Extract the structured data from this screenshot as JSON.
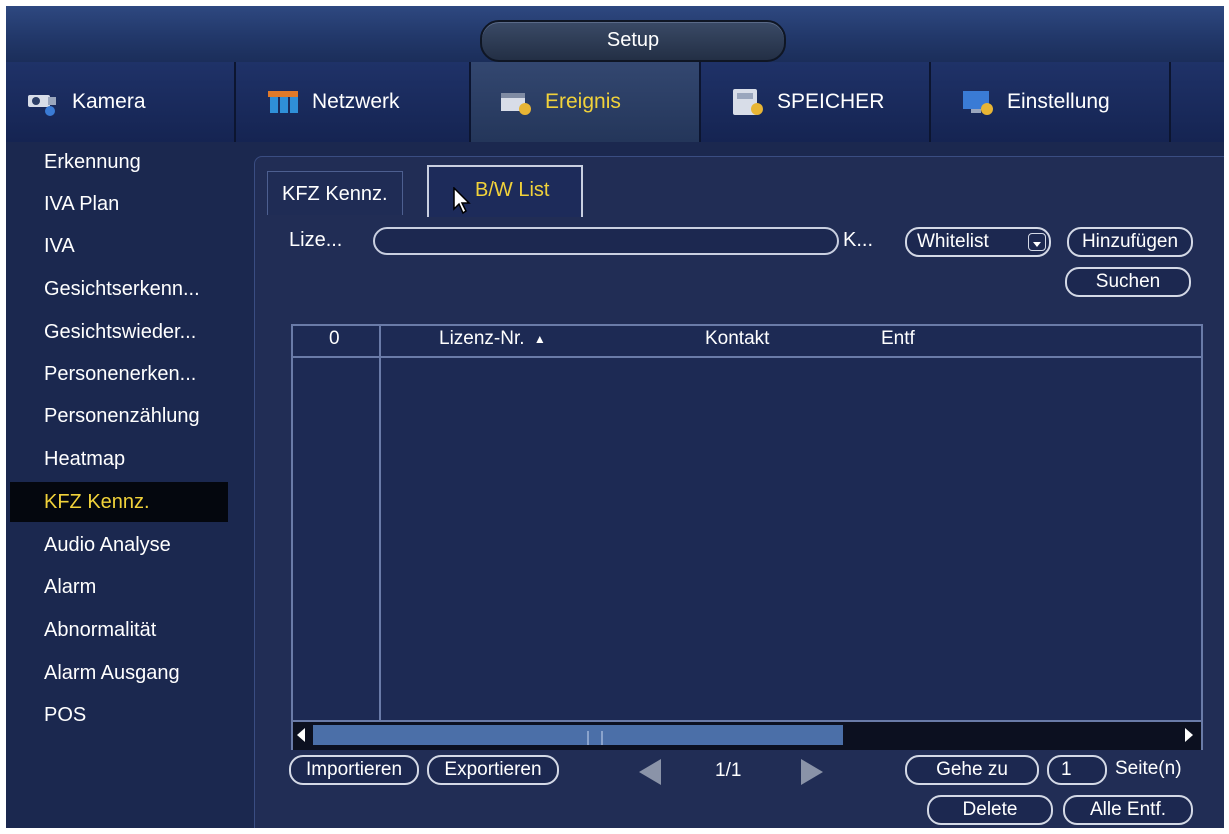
{
  "window": {
    "title": "Setup"
  },
  "top_tabs": [
    {
      "label": "Kamera",
      "icon": "camera-icon"
    },
    {
      "label": "Netzwerk",
      "icon": "network-icon"
    },
    {
      "label": "Ereignis",
      "icon": "event-icon",
      "active": true
    },
    {
      "label": "SPEICHER",
      "icon": "storage-icon"
    },
    {
      "label": "Einstellung",
      "icon": "settings-icon"
    }
  ],
  "sidebar": {
    "items": [
      {
        "label": "Erkennung"
      },
      {
        "label": "IVA Plan"
      },
      {
        "label": "IVA"
      },
      {
        "label": "Gesichtserkenn..."
      },
      {
        "label": "Gesichtswieder..."
      },
      {
        "label": "Personenerken..."
      },
      {
        "label": "Personenzählung"
      },
      {
        "label": "Heatmap"
      },
      {
        "label": "KFZ Kennz.",
        "active": true
      },
      {
        "label": "Audio Analyse"
      },
      {
        "label": "Alarm"
      },
      {
        "label": "Abnormalität"
      },
      {
        "label": "Alarm Ausgang"
      },
      {
        "label": "POS"
      }
    ]
  },
  "sub_tabs": [
    {
      "label": "KFZ Kennz."
    },
    {
      "label": "B/W List",
      "active": true
    }
  ],
  "form": {
    "license_label": "Lize...",
    "license_value": "",
    "k_label": "K...",
    "list_type": "Whitelist",
    "add_label": "Hinzufügen",
    "search_label": "Suchen"
  },
  "table": {
    "count": "0",
    "columns": [
      "Lizenz-Nr.",
      "Kontakt",
      "Entf"
    ],
    "sort_indicator": "▲",
    "rows": []
  },
  "footer": {
    "import_label": "Importieren",
    "export_label": "Exportieren",
    "page": "1/1",
    "goto_label": "Gehe zu",
    "page_input": "1",
    "page_unit": "Seite(n)",
    "delete_label": "Delete",
    "delete_all_label": "Alle Entf."
  },
  "colors": {
    "accent": "#f1d23a",
    "background": "#1b284f",
    "panel": "#212d55"
  }
}
